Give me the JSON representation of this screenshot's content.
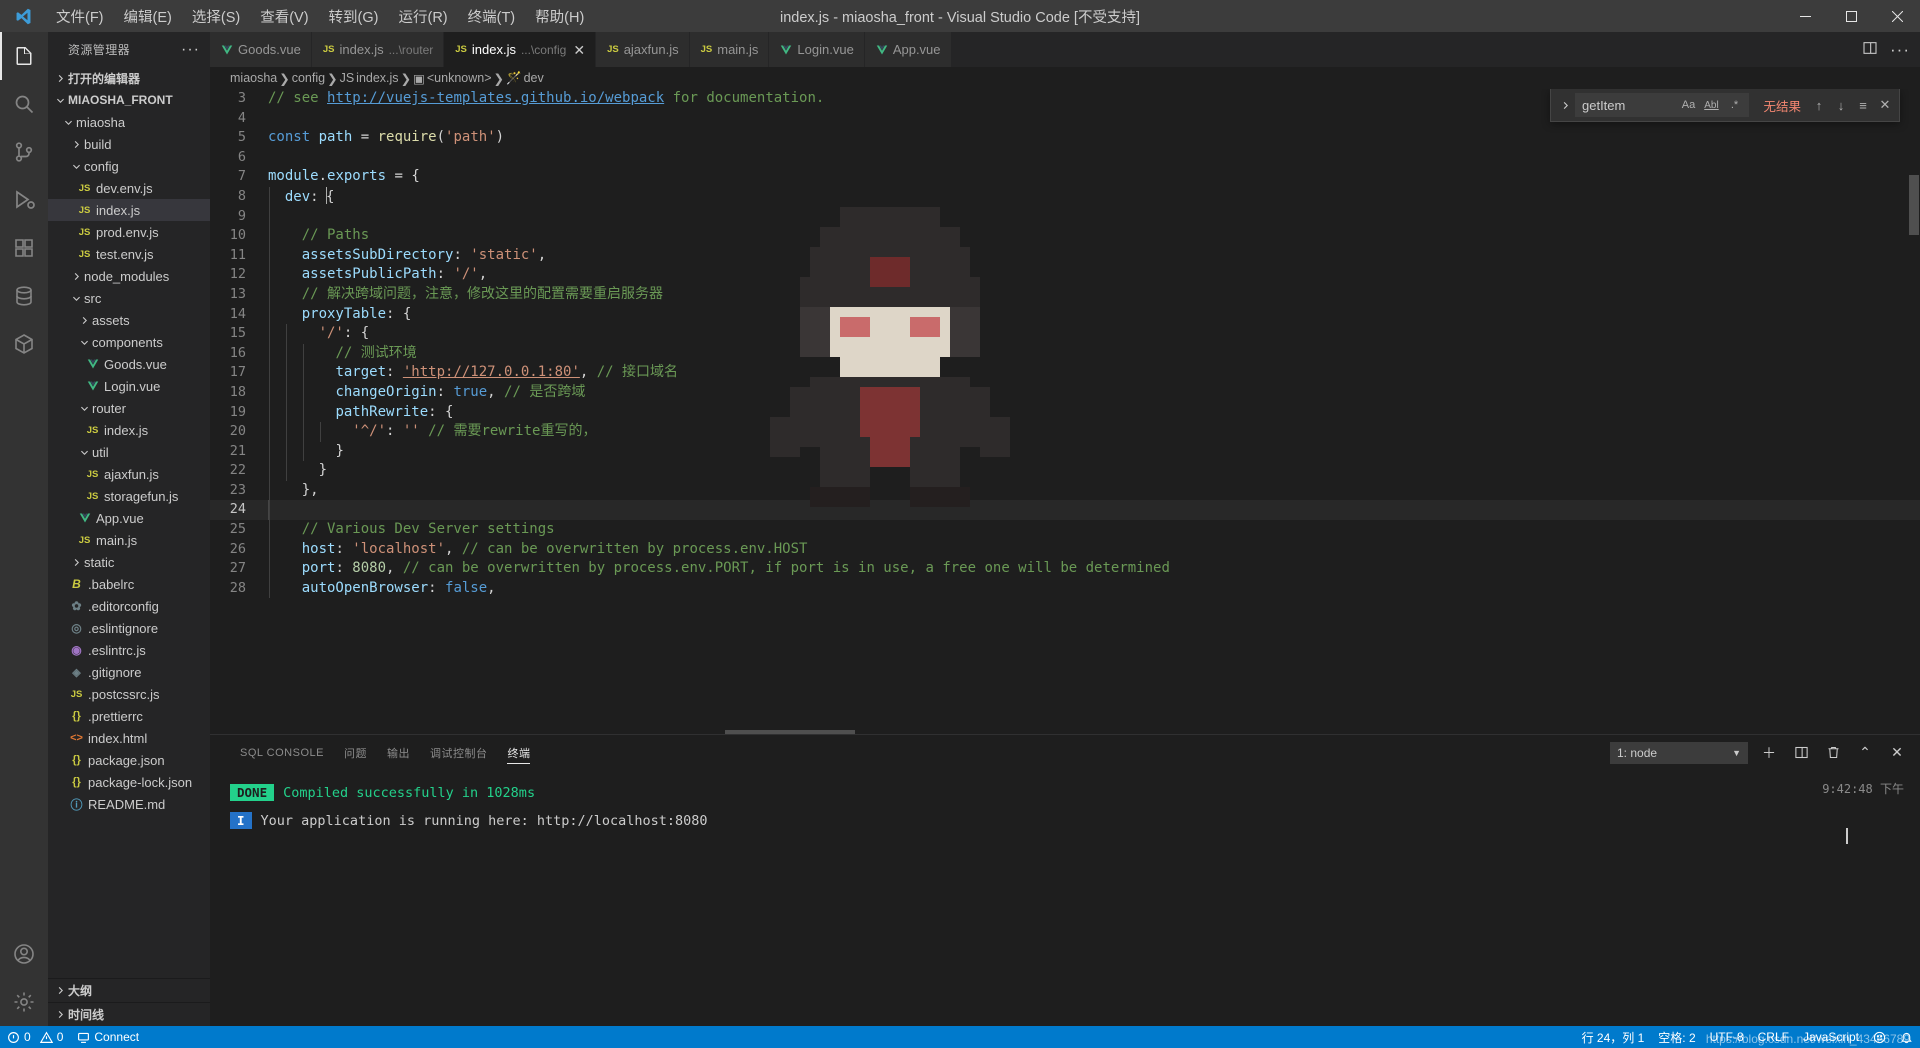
{
  "titlebar": {
    "title": "index.js - miaosha_front - Visual Studio Code [不受支持]",
    "menu": [
      "文件(F)",
      "编辑(E)",
      "选择(S)",
      "查看(V)",
      "转到(G)",
      "运行(R)",
      "终端(T)",
      "帮助(H)"
    ],
    "window_controls": [
      "minimize",
      "maximize",
      "close"
    ]
  },
  "activitybar": {
    "items": [
      {
        "name": "explorer",
        "icon": "files-icon",
        "active": true
      },
      {
        "name": "search",
        "icon": "search-icon",
        "active": false
      },
      {
        "name": "source-control",
        "icon": "source-control-icon",
        "active": false
      },
      {
        "name": "run-debug",
        "icon": "run-debug-icon",
        "active": false
      },
      {
        "name": "extensions",
        "icon": "extensions-icon",
        "active": false
      },
      {
        "name": "database",
        "icon": "database-icon",
        "active": false
      },
      {
        "name": "package",
        "icon": "package-icon",
        "active": false
      }
    ],
    "bottom": [
      {
        "name": "accounts",
        "icon": "account-icon"
      },
      {
        "name": "settings",
        "icon": "gear-icon"
      }
    ]
  },
  "sidebar": {
    "header": "资源管理器",
    "open_editors": "打开的编辑器",
    "root": "MIAOSHA_FRONT",
    "bottom_sections": [
      "大纲",
      "时间线"
    ],
    "tree": [
      {
        "label": "miaosha",
        "indent": 1,
        "type": "folder",
        "expanded": true
      },
      {
        "label": "build",
        "indent": 2,
        "type": "folder",
        "expanded": false
      },
      {
        "label": "config",
        "indent": 2,
        "type": "folder",
        "expanded": true
      },
      {
        "label": "dev.env.js",
        "indent": 3,
        "type": "js"
      },
      {
        "label": "index.js",
        "indent": 3,
        "type": "js",
        "selected": true
      },
      {
        "label": "prod.env.js",
        "indent": 3,
        "type": "js"
      },
      {
        "label": "test.env.js",
        "indent": 3,
        "type": "js"
      },
      {
        "label": "node_modules",
        "indent": 2,
        "type": "folder",
        "expanded": false
      },
      {
        "label": "src",
        "indent": 2,
        "type": "folder",
        "expanded": true
      },
      {
        "label": "assets",
        "indent": 3,
        "type": "folder",
        "expanded": false
      },
      {
        "label": "components",
        "indent": 3,
        "type": "folder",
        "expanded": true
      },
      {
        "label": "Goods.vue",
        "indent": 4,
        "type": "vue"
      },
      {
        "label": "Login.vue",
        "indent": 4,
        "type": "vue"
      },
      {
        "label": "router",
        "indent": 3,
        "type": "folder",
        "expanded": true
      },
      {
        "label": "index.js",
        "indent": 4,
        "type": "js"
      },
      {
        "label": "util",
        "indent": 3,
        "type": "folder",
        "expanded": true
      },
      {
        "label": "ajaxfun.js",
        "indent": 4,
        "type": "js"
      },
      {
        "label": "storagefun.js",
        "indent": 4,
        "type": "js"
      },
      {
        "label": "App.vue",
        "indent": 3,
        "type": "vue"
      },
      {
        "label": "main.js",
        "indent": 3,
        "type": "js"
      },
      {
        "label": "static",
        "indent": 2,
        "type": "folder",
        "expanded": false
      },
      {
        "label": ".babelrc",
        "indent": 2,
        "type": "babel"
      },
      {
        "label": ".editorconfig",
        "indent": 2,
        "type": "gear"
      },
      {
        "label": ".eslintignore",
        "indent": 2,
        "type": "eslint1"
      },
      {
        "label": ".eslintrc.js",
        "indent": 2,
        "type": "eslint2"
      },
      {
        "label": ".gitignore",
        "indent": 2,
        "type": "git"
      },
      {
        "label": ".postcssrc.js",
        "indent": 2,
        "type": "js"
      },
      {
        "label": ".prettierrc",
        "indent": 2,
        "type": "json"
      },
      {
        "label": "index.html",
        "indent": 2,
        "type": "html"
      },
      {
        "label": "package.json",
        "indent": 2,
        "type": "json"
      },
      {
        "label": "package-lock.json",
        "indent": 2,
        "type": "json"
      },
      {
        "label": "README.md",
        "indent": 2,
        "type": "md"
      }
    ]
  },
  "tabs": [
    {
      "label": "Goods.vue",
      "desc": "",
      "type": "vue",
      "active": false
    },
    {
      "label": "index.js",
      "desc": "...\\router",
      "type": "js",
      "active": false
    },
    {
      "label": "index.js",
      "desc": "...\\config",
      "type": "js",
      "active": true
    },
    {
      "label": "ajaxfun.js",
      "desc": "",
      "type": "js",
      "active": false
    },
    {
      "label": "main.js",
      "desc": "",
      "type": "js",
      "active": false
    },
    {
      "label": "Login.vue",
      "desc": "",
      "type": "vue",
      "active": false
    },
    {
      "label": "App.vue",
      "desc": "",
      "type": "vue",
      "active": false
    }
  ],
  "breadcrumb": [
    "miaosha",
    "config",
    "index.js",
    "<unknown>",
    "dev"
  ],
  "find_widget": {
    "value": "getItem",
    "match_case": "Aa",
    "whole_word": "Abl",
    "regex": ".*",
    "result": "无结果",
    "buttons": [
      "previous-match",
      "next-match",
      "find-in-selection",
      "close"
    ]
  },
  "editor": {
    "first_line": 3,
    "current_line": 24,
    "lines": [
      {
        "n": 3,
        "tokens": [
          {
            "t": "cmt",
            "v": "// see "
          },
          {
            "t": "lnk",
            "v": "http://vuejs-templates.github.io/webpack"
          },
          {
            "t": "cmt",
            "v": " for documentation."
          }
        ]
      },
      {
        "n": 4,
        "tokens": []
      },
      {
        "n": 5,
        "tokens": [
          {
            "t": "kw",
            "v": "const "
          },
          {
            "t": "var",
            "v": "path"
          },
          {
            "t": "pun",
            "v": " = "
          },
          {
            "t": "fn",
            "v": "require"
          },
          {
            "t": "pun",
            "v": "("
          },
          {
            "t": "str",
            "v": "'path'"
          },
          {
            "t": "pun",
            "v": ")"
          }
        ]
      },
      {
        "n": 6,
        "tokens": []
      },
      {
        "n": 7,
        "tokens": [
          {
            "t": "var",
            "v": "module"
          },
          {
            "t": "pun",
            "v": "."
          },
          {
            "t": "prop",
            "v": "exports"
          },
          {
            "t": "pun",
            "v": " = {"
          }
        ]
      },
      {
        "n": 8,
        "tokens": [
          {
            "t": "pad",
            "v": "  "
          },
          {
            "t": "prop",
            "v": "dev"
          },
          {
            "t": "pun",
            "v": ": "
          },
          {
            "t": "caret",
            "v": "{"
          }
        ]
      },
      {
        "n": 9,
        "tokens": []
      },
      {
        "n": 10,
        "tokens": [
          {
            "t": "pad",
            "v": "    "
          },
          {
            "t": "cmt",
            "v": "// Paths"
          }
        ]
      },
      {
        "n": 11,
        "tokens": [
          {
            "t": "pad",
            "v": "    "
          },
          {
            "t": "prop",
            "v": "assetsSubDirectory"
          },
          {
            "t": "pun",
            "v": ": "
          },
          {
            "t": "str",
            "v": "'static'"
          },
          {
            "t": "pun",
            "v": ","
          }
        ]
      },
      {
        "n": 12,
        "tokens": [
          {
            "t": "pad",
            "v": "    "
          },
          {
            "t": "prop",
            "v": "assetsPublicPath"
          },
          {
            "t": "pun",
            "v": ": "
          },
          {
            "t": "str",
            "v": "'/'"
          },
          {
            "t": "pun",
            "v": ","
          }
        ]
      },
      {
        "n": 13,
        "tokens": [
          {
            "t": "pad",
            "v": "    "
          },
          {
            "t": "cmt",
            "v": "// 解决跨域问题，注意，修改这里的配置需要重启服务器"
          }
        ]
      },
      {
        "n": 14,
        "tokens": [
          {
            "t": "pad",
            "v": "    "
          },
          {
            "t": "prop",
            "v": "proxyTable"
          },
          {
            "t": "pun",
            "v": ": {"
          }
        ]
      },
      {
        "n": 15,
        "tokens": [
          {
            "t": "pad",
            "v": "      "
          },
          {
            "t": "str",
            "v": "'/'"
          },
          {
            "t": "pun",
            "v": ": {"
          }
        ]
      },
      {
        "n": 16,
        "tokens": [
          {
            "t": "pad",
            "v": "        "
          },
          {
            "t": "cmt",
            "v": "// 测试环境"
          }
        ]
      },
      {
        "n": 17,
        "tokens": [
          {
            "t": "pad",
            "v": "        "
          },
          {
            "t": "prop",
            "v": "target"
          },
          {
            "t": "pun",
            "v": ": "
          },
          {
            "t": "strlnk",
            "v": "'http://127.0.0.1:80'"
          },
          {
            "t": "pun",
            "v": ", "
          },
          {
            "t": "cmt",
            "v": "// 接口域名"
          }
        ]
      },
      {
        "n": 18,
        "tokens": [
          {
            "t": "pad",
            "v": "        "
          },
          {
            "t": "prop",
            "v": "changeOrigin"
          },
          {
            "t": "pun",
            "v": ": "
          },
          {
            "t": "kw",
            "v": "true"
          },
          {
            "t": "pun",
            "v": ", "
          },
          {
            "t": "cmt",
            "v": "// 是否跨域"
          }
        ]
      },
      {
        "n": 19,
        "tokens": [
          {
            "t": "pad",
            "v": "        "
          },
          {
            "t": "prop",
            "v": "pathRewrite"
          },
          {
            "t": "pun",
            "v": ": {"
          }
        ]
      },
      {
        "n": 20,
        "tokens": [
          {
            "t": "pad",
            "v": "          "
          },
          {
            "t": "str",
            "v": "'^/'"
          },
          {
            "t": "pun",
            "v": ": "
          },
          {
            "t": "str",
            "v": "''"
          },
          {
            "t": "pun",
            "v": " "
          },
          {
            "t": "cmt",
            "v": "// 需要rewrite重写的，"
          }
        ]
      },
      {
        "n": 21,
        "tokens": [
          {
            "t": "pad",
            "v": "        "
          },
          {
            "t": "pun",
            "v": "}"
          }
        ]
      },
      {
        "n": 22,
        "tokens": [
          {
            "t": "pad",
            "v": "      "
          },
          {
            "t": "pun",
            "v": "}"
          }
        ]
      },
      {
        "n": 23,
        "tokens": [
          {
            "t": "pad",
            "v": "    "
          },
          {
            "t": "pun",
            "v": "},"
          }
        ]
      },
      {
        "n": 24,
        "tokens": []
      },
      {
        "n": 25,
        "tokens": [
          {
            "t": "pad",
            "v": "    "
          },
          {
            "t": "cmt",
            "v": "// Various Dev Server settings"
          }
        ]
      },
      {
        "n": 26,
        "tokens": [
          {
            "t": "pad",
            "v": "    "
          },
          {
            "t": "prop",
            "v": "host"
          },
          {
            "t": "pun",
            "v": ": "
          },
          {
            "t": "str",
            "v": "'localhost'"
          },
          {
            "t": "pun",
            "v": ", "
          },
          {
            "t": "cmt",
            "v": "// can be overwritten by process.env.HOST"
          }
        ]
      },
      {
        "n": 27,
        "tokens": [
          {
            "t": "pad",
            "v": "    "
          },
          {
            "t": "prop",
            "v": "port"
          },
          {
            "t": "pun",
            "v": ": "
          },
          {
            "t": "num",
            "v": "8080"
          },
          {
            "t": "pun",
            "v": ", "
          },
          {
            "t": "cmt",
            "v": "// can be overwritten by process.env.PORT, if port is in use, a free one will be determined"
          }
        ]
      },
      {
        "n": 28,
        "tokens": [
          {
            "t": "pad",
            "v": "    "
          },
          {
            "t": "prop",
            "v": "autoOpenBrowser"
          },
          {
            "t": "pun",
            "v": ": "
          },
          {
            "t": "kw",
            "v": "false"
          },
          {
            "t": "pun",
            "v": ","
          }
        ]
      }
    ]
  },
  "panel": {
    "tabs": [
      "SQL CONSOLE",
      "问题",
      "输出",
      "调试控制台",
      "终端"
    ],
    "active_tab": "终端",
    "terminal_select": "1: node",
    "buttons": [
      "new-terminal",
      "split-terminal",
      "kill-terminal",
      "maximize-panel",
      "close-panel"
    ],
    "lines": [
      {
        "badge": "DONE",
        "badge_type": "done",
        "text": "Compiled successfully in 1028ms"
      },
      {
        "badge": "I",
        "badge_type": "info",
        "text": "Your application is running here: http://localhost:8080"
      }
    ],
    "time": "9:42:48 下午"
  },
  "statusbar": {
    "errors": "0",
    "warnings": "0",
    "connect": "Connect",
    "position": "行 24，列 1",
    "spaces": "空格: 2",
    "encoding": "UTF-8",
    "eol": "CRLF",
    "language": "JavaScript",
    "feedback": "smile-icon",
    "bell": "bell-icon",
    "watermark": "https://blog.csdn.net/weixin_43466789"
  },
  "colors": {
    "accent": "#007acc",
    "titlebar_bg": "#3c3c3c",
    "sidebar_bg": "#252526",
    "editor_bg": "#1e1e1e",
    "activitybar_bg": "#333333",
    "success": "#23d18b",
    "error": "#f48771"
  }
}
